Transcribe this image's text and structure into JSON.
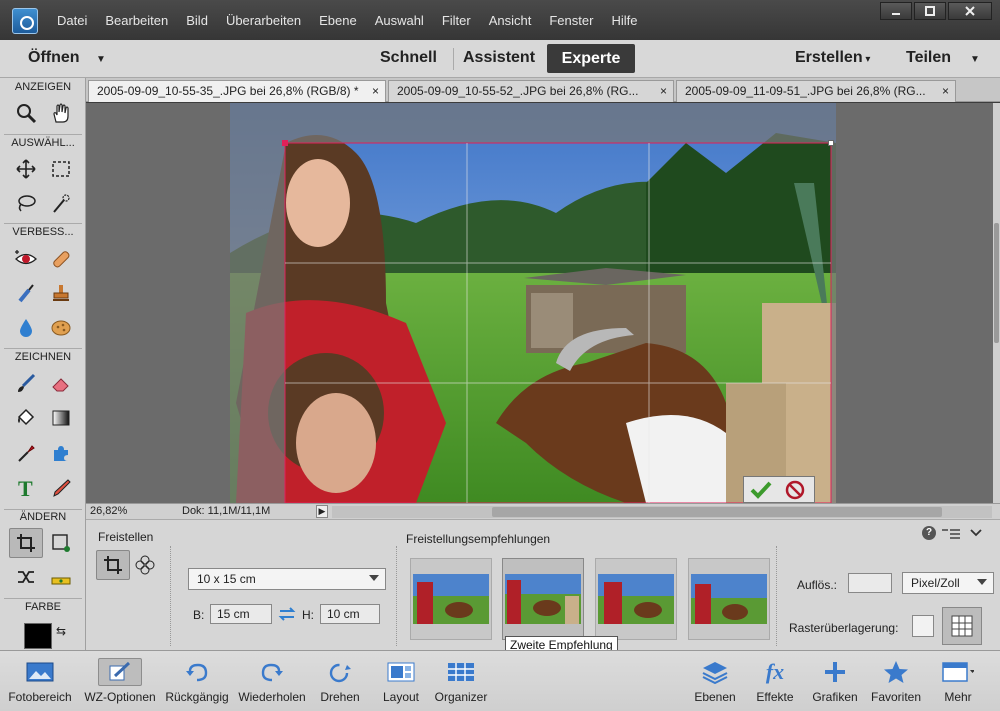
{
  "menubar": {
    "items": [
      "Datei",
      "Bearbeiten",
      "Bild",
      "Überarbeiten",
      "Ebene",
      "Auswahl",
      "Filter",
      "Ansicht",
      "Fenster",
      "Hilfe"
    ]
  },
  "modebar": {
    "open_label": "Öffnen",
    "modes": [
      "Schnell",
      "Assistent",
      "Experte"
    ],
    "active_mode": "Experte",
    "create_label": "Erstellen",
    "share_label": "Teilen"
  },
  "toolbox": {
    "sections": [
      "ANZEIGEN",
      "AUSWÄHL...",
      "VERBESS...",
      "ZEICHNEN",
      "ÄNDERN",
      "FARBE"
    ],
    "foreground_color": "#000000"
  },
  "tabs": [
    {
      "label": "2005-09-09_10-55-35_.JPG bei 26,8% (RGB/8) *",
      "active": true
    },
    {
      "label": "2005-09-09_10-55-52_.JPG bei 26,8% (RG...",
      "active": false
    },
    {
      "label": "2005-09-09_11-09-51_.JPG bei 26,8% (RG...",
      "active": false
    }
  ],
  "statusbar": {
    "zoom": "26,82%",
    "doc": "Dok: 11,1M/11,1M"
  },
  "options": {
    "tool_title": "Freistellen",
    "preset_value": "10 x 15 cm",
    "width_label": "B:",
    "width_value": "15 cm",
    "height_label": "H:",
    "height_value": "10 cm",
    "recommendations_title": "Freistellungsempfehlungen",
    "tooltip": "Zweite Empfehlung",
    "resolution_label": "Auflös.:",
    "resolution_value": "",
    "unit_value": "Pixel/Zoll",
    "grid_overlay_label": "Rasterüberlagerung:"
  },
  "bottombar": {
    "items": [
      "Fotobereich",
      "WZ-Optionen",
      "Rückgängig",
      "Wiederholen",
      "Drehen",
      "Layout",
      "Organizer",
      "Ebenen",
      "Effekte",
      "Grafiken",
      "Favoriten",
      "Mehr"
    ]
  },
  "colors": {
    "accent_dark": "#3a3a3a",
    "crop_handle": "#e0205a",
    "commit_green": "#3c9a2c",
    "cancel_red": "#b0182a"
  }
}
